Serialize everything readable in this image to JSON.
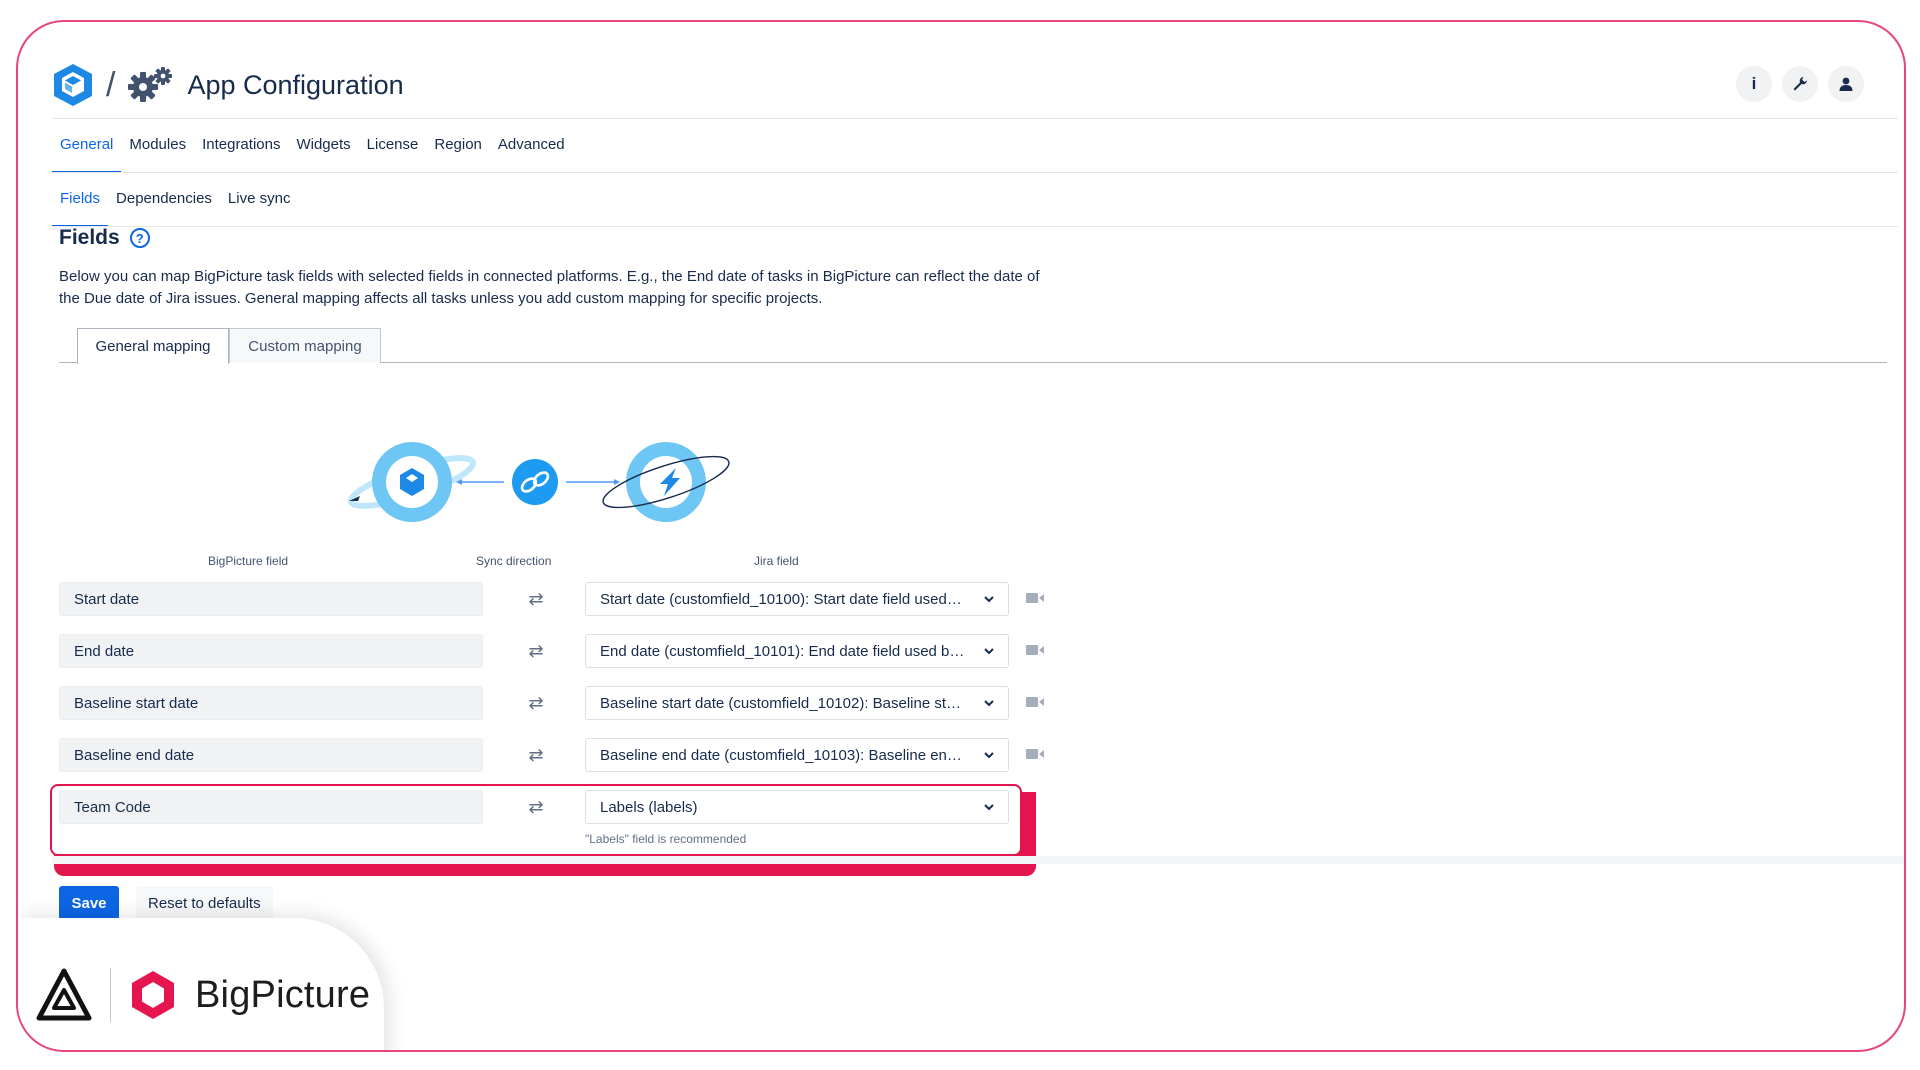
{
  "header": {
    "title": "App Configuration",
    "actions": [
      {
        "name": "info-button",
        "icon": "info-icon",
        "glyph": "i"
      },
      {
        "name": "settings-button",
        "icon": "wrench-icon"
      },
      {
        "name": "profile-button",
        "icon": "user-icon"
      }
    ]
  },
  "nav": {
    "tabs": [
      "General",
      "Modules",
      "Integrations",
      "Widgets",
      "License",
      "Region",
      "Advanced"
    ],
    "active": "General"
  },
  "subnav": {
    "tabs": [
      "Fields",
      "Dependencies",
      "Live sync"
    ],
    "active": "Fields"
  },
  "section": {
    "title": "Fields",
    "description": "Below you can map BigPicture task fields with selected fields in connected platforms. E.g., the End date of tasks in BigPicture can reflect the date of the Due date of Jira issues. General mapping affects all tasks unless you add custom mapping for specific projects."
  },
  "mapping_tabs": [
    "General mapping",
    "Custom mapping"
  ],
  "columns": {
    "bigpicture": "BigPicture field",
    "sync": "Sync direction",
    "jira": "Jira field"
  },
  "rows": [
    {
      "bp_field": "Start date",
      "jira_field": "Start date (customfield_10100): Start date field used…"
    },
    {
      "bp_field": "End date",
      "jira_field": "End date (customfield_10101): End date field used b…"
    },
    {
      "bp_field": "Baseline start date",
      "jira_field": "Baseline start date (customfield_10102): Baseline st…"
    },
    {
      "bp_field": "Baseline end date",
      "jira_field": "Baseline end date (customfield_10103): Baseline en…"
    },
    {
      "bp_field": "Team Code",
      "jira_field": "Labels (labels)",
      "hint": "\"Labels\" field is recommended"
    }
  ],
  "footer": {
    "save_label": "Save",
    "reset_label": "Reset to defaults"
  },
  "brand": {
    "name": "BigPicture"
  },
  "colors": {
    "accent": "#0c66e4",
    "highlight": "#e5154f",
    "frame": "#e8457a",
    "bubble": "#6ec6f5"
  }
}
